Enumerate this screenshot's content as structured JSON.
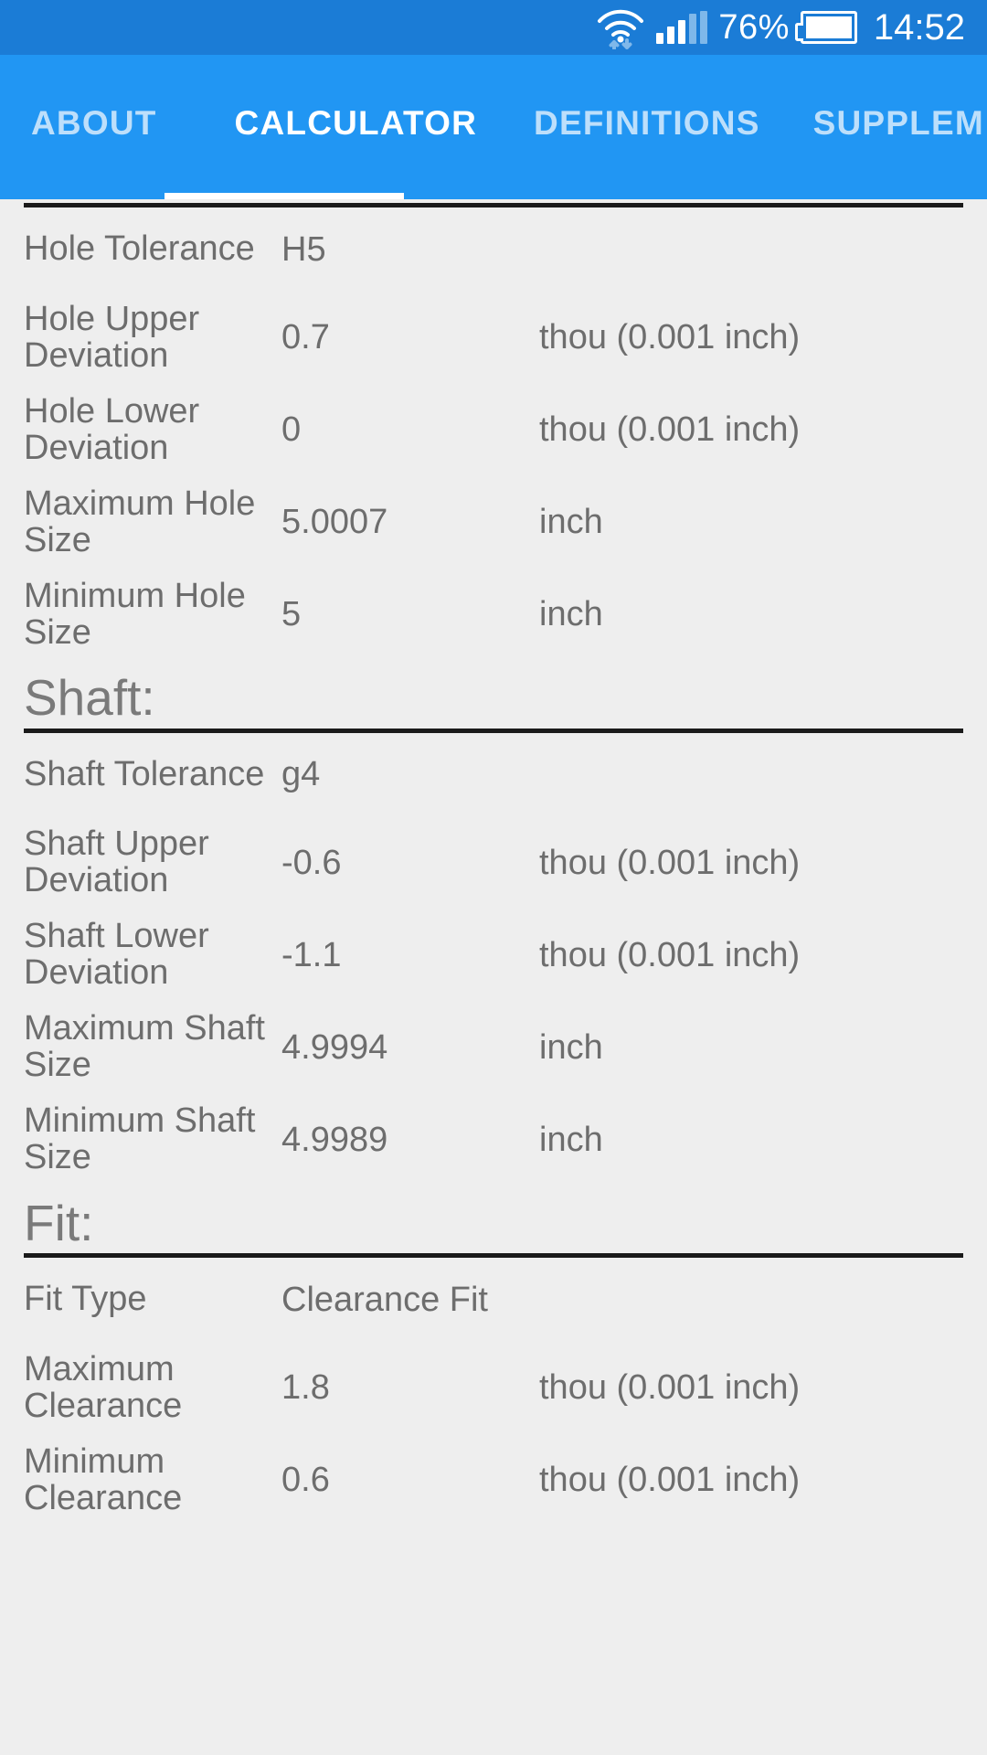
{
  "status_bar": {
    "wifi_icon": "wifi-icon",
    "signal_icon": "signal-bars-icon",
    "battery_percent": "76%",
    "battery_icon": "battery-icon",
    "time": "14:52"
  },
  "tabs": [
    {
      "label": "ABOUT",
      "active": false
    },
    {
      "label": "CALCULATOR",
      "active": true
    },
    {
      "label": "DEFINITIONS",
      "active": false
    },
    {
      "label": "SUPPLEM",
      "active": false
    }
  ],
  "sections": [
    {
      "header": null,
      "rows": [
        {
          "label": "Hole Tolerance",
          "value": "H5",
          "unit": ""
        },
        {
          "label": "Hole Upper Deviation",
          "value": "0.7",
          "unit": "thou (0.001 inch)"
        },
        {
          "label": "Hole Lower Deviation",
          "value": "0",
          "unit": "thou (0.001 inch)"
        },
        {
          "label": "Maximum Hole Size",
          "value": "5.0007",
          "unit": "inch"
        },
        {
          "label": "Minimum Hole Size",
          "value": "5",
          "unit": "inch"
        }
      ]
    },
    {
      "header": "Shaft:",
      "rows": [
        {
          "label": "Shaft Tolerance",
          "value": "g4",
          "unit": ""
        },
        {
          "label": "Shaft Upper Deviation",
          "value": "-0.6",
          "unit": "thou (0.001 inch)"
        },
        {
          "label": "Shaft Lower Deviation",
          "value": "-1.1",
          "unit": "thou (0.001 inch)"
        },
        {
          "label": "Maximum Shaft Size",
          "value": "4.9994",
          "unit": "inch"
        },
        {
          "label": "Minimum Shaft Size",
          "value": "4.9989",
          "unit": "inch"
        }
      ]
    },
    {
      "header": "Fit:",
      "rows": [
        {
          "label": "Fit Type",
          "value": "Clearance Fit",
          "unit": ""
        },
        {
          "label": "Maximum Clearance",
          "value": "1.8",
          "unit": "thou (0.001 inch)"
        },
        {
          "label": "Minimum Clearance",
          "value": "0.6",
          "unit": "thou (0.001 inch)"
        }
      ]
    }
  ],
  "colors": {
    "status_bar": "#1b7cd6",
    "tab_bar": "#2196f3",
    "content_bg": "#eeeeee",
    "text": "#6d6d6d",
    "rule": "#1a1a1a",
    "tab_active": "#ffffff",
    "tab_inactive": "#bddffb"
  }
}
